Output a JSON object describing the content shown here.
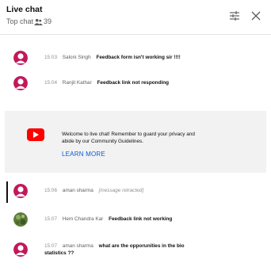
{
  "header": {
    "title": "Live chat",
    "subtitle": "Top chat",
    "viewers": "39"
  },
  "icons": {
    "filter": "sliders-icon",
    "close": "close-icon",
    "people": "people-icon",
    "youtube": "youtube-logo-icon"
  },
  "colors": {
    "avatar_red": "#c2185b",
    "link_blue": "#065fd4",
    "youtube_red": "#ff0000"
  },
  "messages": [
    {
      "time": "15:03",
      "author": "Saloni Singh",
      "text": "Feedback form isn't working sir !!!!"
    },
    {
      "time": "15:04",
      "author": "Ranjit Kathar",
      "text": "Feedback link not responding"
    },
    {
      "time": "15:06",
      "author": "aman sharma",
      "text": "[message retracted]"
    },
    {
      "time": "15:07",
      "author": "Hem Chandra Kar",
      "text": "Feedback link not working"
    },
    {
      "time": "15:07",
      "author": "aman sharma",
      "text": "what are the opporunities in the bio",
      "text2": "statistics ??"
    }
  ],
  "welcome": {
    "line1": "Welcome to live chat! Remember to guard your privacy and",
    "line2": "abide by our Community Guidelines.",
    "link": "LEARN MORE"
  }
}
